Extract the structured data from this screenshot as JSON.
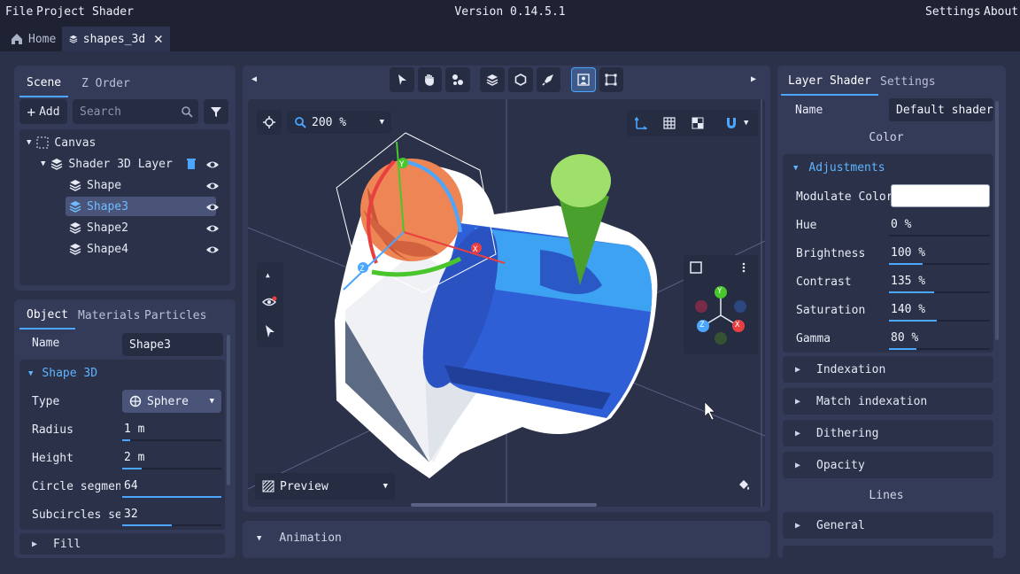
{
  "menu": {
    "file": "File",
    "project": "Project",
    "shader": "Shader",
    "settings": "Settings",
    "about": "About"
  },
  "version": "Version 0.14.5.1",
  "tabs": [
    {
      "label": "Home"
    },
    {
      "label": "shapes_3d"
    }
  ],
  "scene_panel": {
    "tabs": [
      "Scene",
      "Z Order"
    ],
    "add_label": "Add",
    "search_placeholder": "Search",
    "tree": {
      "canvas": "Canvas",
      "layer": "Shader 3D Layer",
      "items": [
        "Shape",
        "Shape3",
        "Shape2",
        "Shape4"
      ]
    }
  },
  "object_panel": {
    "tabs": [
      "Object",
      "Materials",
      "Particles"
    ],
    "name_label": "Name",
    "name_value": "Shape3",
    "section": "Shape 3D",
    "type_label": "Type",
    "type_value": "Sphere",
    "fields": [
      {
        "label": "Radius",
        "value": "1 m",
        "level": 0.08
      },
      {
        "label": "Height",
        "value": "2 m",
        "level": 0.2
      },
      {
        "label": "Circle segments",
        "value": "64",
        "level": 1.0
      },
      {
        "label": "Subcircles segm",
        "value": "32",
        "level": 0.5
      }
    ],
    "fill_section": "Fill"
  },
  "viewport": {
    "zoom": "200 %",
    "preview_label": "Preview",
    "axis_labels": {
      "y": "Y",
      "x": "X",
      "z": "Z"
    }
  },
  "animation": {
    "label": "Animation"
  },
  "layer_panel": {
    "tabs": [
      "Layer Shader",
      "Settings"
    ],
    "name_label": "Name",
    "name_value": "Default shader",
    "color_header": "Color",
    "adjustments": "Adjustments",
    "modulate_label": "Modulate Color",
    "modulate_color": "#ffffff",
    "adj_fields": [
      {
        "label": "Hue",
        "value": "0 %",
        "level": 0.0
      },
      {
        "label": "Brightness",
        "value": "100 %",
        "level": 0.33
      },
      {
        "label": "Contrast",
        "value": "135 %",
        "level": 0.45
      },
      {
        "label": "Saturation",
        "value": "140 %",
        "level": 0.47
      },
      {
        "label": "Gamma",
        "value": "80 %",
        "level": 0.27
      }
    ],
    "collapsed": [
      "Indexation",
      "Match indexation",
      "Dithering",
      "Opacity"
    ],
    "lines_header": "Lines",
    "lines_items": [
      "General"
    ]
  },
  "colors": {
    "accent": "#4aa6ff",
    "panel": "#343b59",
    "bg": "#1e2233"
  }
}
